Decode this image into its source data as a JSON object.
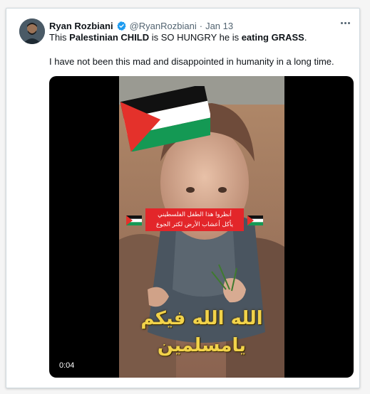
{
  "tweet": {
    "author_name": "Ryan Rozbiani",
    "handle": "@RyanRozbiani",
    "separator": "·",
    "date": "Jan 13",
    "line1": {
      "pre": "This ",
      "bold1": "Palestinian CHILD",
      "mid": " is SO HUNGRY he is ",
      "bold2": "eating GRASS",
      "post": "."
    },
    "line2": "I have not been this mad and disappointed in humanity in a long time."
  },
  "icons": {
    "verified": "verified-badge-icon",
    "more": "more-options-icon",
    "flag": "palestine-flag-icon"
  },
  "video": {
    "timestamp": "0:04",
    "caption_line1": "أنظروا هذا الطفل الفلسطيني",
    "caption_line2": "يأكل أعشاب الأرض لكثر الجوع",
    "overlay_line1": "الله الله فيكم",
    "overlay_line2": "يامسلمين"
  },
  "colors": {
    "verified_blue": "#1d9bf0",
    "caption_red": "#e3262a",
    "overlay_gold": "#f2d34a",
    "flag_green": "#149954",
    "flag_red": "#e4312b"
  }
}
